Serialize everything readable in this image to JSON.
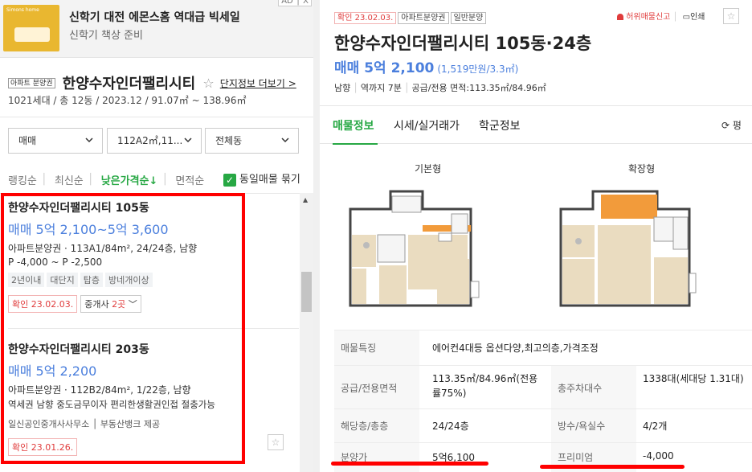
{
  "ad": {
    "logo": "Simons home",
    "title": "신학기 대전 에몬스홈 역대급 빅세일",
    "subtitle": "신학기 책상 준비",
    "badge": "AD │ X"
  },
  "complex": {
    "type_tag": "아파트 분양권",
    "name": "한양수자인더팰리시티",
    "star": "☆",
    "more": "단지정보 더보기 >",
    "meta": "1021세대 / 총 12동 / 2023.12 / 91.07㎡ ~ 138.96㎡"
  },
  "filters": {
    "trade": "매매",
    "area": "112A2㎡,11...",
    "dong": "전체동"
  },
  "sort": {
    "items": [
      "랭킹순",
      "최신순",
      "낮은가격순↓",
      "면적순"
    ],
    "active_index": 2,
    "same_label": "동일매물 묶기",
    "check": "✓"
  },
  "listings": [
    {
      "name": "한양수자인더팰리시티 105동",
      "price": "매매 5억 2,100~5억 3,600",
      "info": "아파트분양권 · 113A1/84m², 24/24층, 남향",
      "premium": "P -4,000 ~ P -2,500",
      "tags": [
        "2년이내",
        "대단지",
        "탑층",
        "방네개이상"
      ],
      "confirm": "확인 23.02.03.",
      "agent_prefix": "중개사 ",
      "agent_count": "2곳",
      "agent_suffix": " ﹀"
    },
    {
      "name": "한양수자인더팰리시티 203동",
      "price": "매매 5억 2,200",
      "info": "아파트분양권 · 112B2/84m², 1/22층, 남향",
      "desc": "역세권 남향 중도금무이자 편리한생활권인접 절충가능",
      "source": "일신공인중개사사무소 │ 부동산뱅크 제공",
      "confirm": "확인 23.01.26.",
      "star": "☆"
    }
  ],
  "detail": {
    "tags": [
      "확인 23.02.03.",
      "아파트분양권",
      "일반분양"
    ],
    "report": "허위매물신고",
    "print": "인쇄",
    "star": "☆",
    "title": "한양수자인더팰리시티 105동·24층",
    "price": "매매 5억 2,100",
    "per_area": "(1,519만원/3.3㎡)",
    "meta_items": [
      "남향",
      "역까지 7분",
      "공급/전용 면적:113.35㎡/84.96㎡"
    ],
    "tabs": [
      "매물정보",
      "시세/실거래가",
      "학군정보"
    ],
    "active_tab": 0,
    "py_toggle": "⟳ 평",
    "floorplans": [
      "기본형",
      "확장형"
    ],
    "table": {
      "feature_label": "매물특징",
      "feature_value": "에어컨4대등 옵션다양,최고의층,가격조정",
      "area_label": "공급/전용면적",
      "area_value": "113.35㎡/84.96㎡(전용률75%)",
      "parking_label": "총주차대수",
      "parking_value": "1338대(세대당 1.31대)",
      "floor_label": "해당층/총층",
      "floor_value": "24/24층",
      "rooms_label": "방수/욕실수",
      "rooms_value": "4/2개",
      "sale_label": "분양가",
      "sale_value": "5억6,100",
      "premium_label": "프리미엄",
      "premium_value": "-4,000"
    }
  },
  "colors": {
    "accent_green": "#27a844",
    "price_blue": "#4b7fdd",
    "confirm_red": "#e03c3c",
    "highlight_red": "#ff0000"
  }
}
